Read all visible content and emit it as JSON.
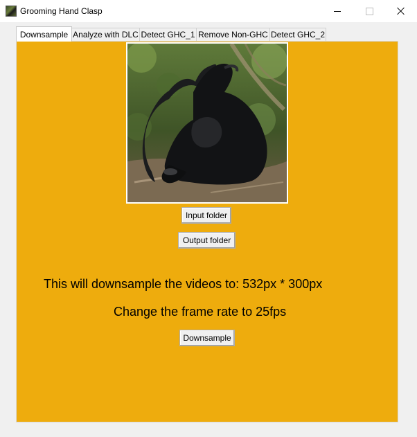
{
  "window": {
    "title": "Grooming Hand Clasp",
    "icon": "chimpanzee-photo-icon"
  },
  "tabs": [
    {
      "label": "Downsample",
      "active": true
    },
    {
      "label": "Analyze with DLC",
      "active": false
    },
    {
      "label": "Detect GHC_1",
      "active": false
    },
    {
      "label": "Remove Non-GHC",
      "active": false
    },
    {
      "label": "Detect GHC_2",
      "active": false
    }
  ],
  "panel": {
    "background_color": "#eeac0d",
    "image_subject": "chimpanzees grooming hand clasp photo",
    "input_folder_label": "Input folder",
    "output_folder_label": "Output folder",
    "downsample_info": "This will downsample the videos to: 532px * 300px",
    "frame_rate_info": "Change the frame rate to 25fps",
    "downsample_label": "Downsample"
  }
}
